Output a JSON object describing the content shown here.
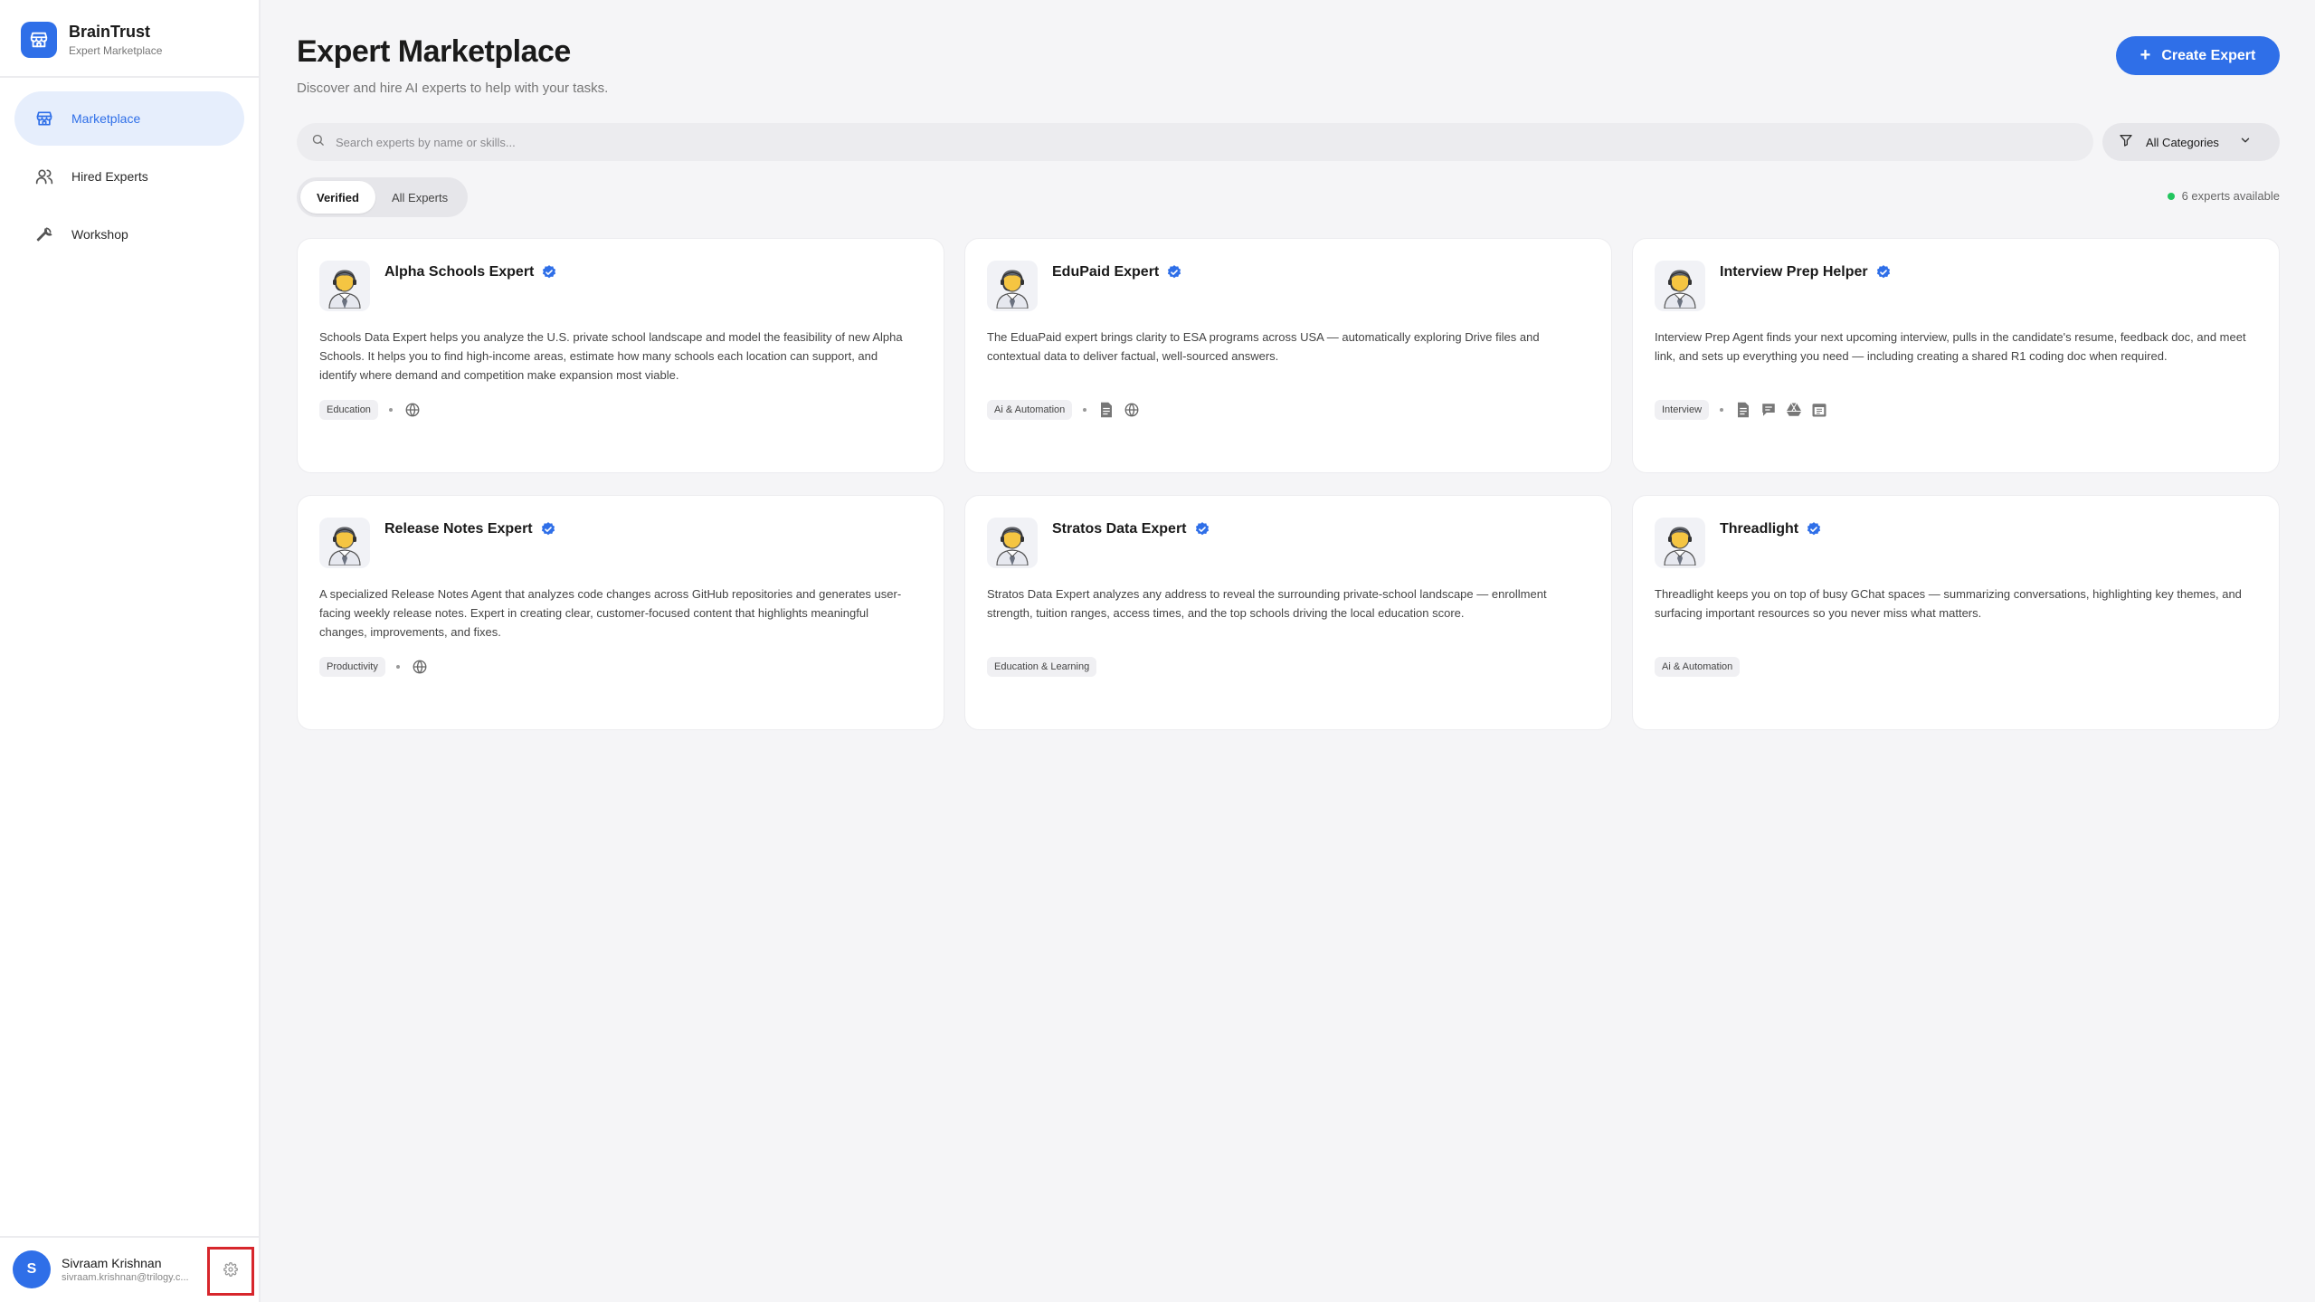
{
  "sidebar": {
    "brand_title": "BrainTrust",
    "brand_subtitle": "Expert Marketplace",
    "items": [
      {
        "label": "Marketplace",
        "icon": "store-icon",
        "active": true
      },
      {
        "label": "Hired Experts",
        "icon": "users-icon",
        "active": false
      },
      {
        "label": "Workshop",
        "icon": "wrench-icon",
        "active": false
      }
    ],
    "user": {
      "initial": "S",
      "name": "Sivraam Krishnan",
      "email": "sivraam.krishnan@trilogy.c..."
    }
  },
  "header": {
    "title": "Expert Marketplace",
    "subtitle": "Discover and hire AI experts to help with your tasks.",
    "create_label": "Create Expert"
  },
  "search": {
    "placeholder": "Search experts by name or skills...",
    "value": ""
  },
  "filter": {
    "selected": "All Categories"
  },
  "tabs": [
    {
      "label": "Verified",
      "active": true
    },
    {
      "label": "All Experts",
      "active": false
    }
  ],
  "available_text": "6 experts available",
  "experts": [
    {
      "name": "Alpha Schools Expert",
      "description": "Schools Data Expert helps you analyze the U.S. private school landscape and model the feasibility of new Alpha Schools. It helps you to find high-income areas, estimate how many schools each location can support, and identify where demand and competition make expansion most viable.",
      "category": "Education",
      "tools": [
        "globe-icon"
      ]
    },
    {
      "name": "EduPaid Expert",
      "description": "The EduaPaid expert brings clarity to ESA programs across USA — automatically exploring Drive files and contextual data to deliver factual, well-sourced answers.",
      "category": "Ai & Automation",
      "tools": [
        "document-icon",
        "globe-icon"
      ]
    },
    {
      "name": "Interview Prep Helper",
      "description": "Interview Prep Agent finds your next upcoming interview, pulls in the candidate's resume, feedback doc, and meet link, and sets up everything you need — including creating a shared R1 coding doc when required.",
      "category": "Interview",
      "tools": [
        "document-icon",
        "chat-icon",
        "drive-icon",
        "calendar-icon"
      ]
    },
    {
      "name": "Release Notes Expert",
      "description": "A specialized Release Notes Agent that analyzes code changes across GitHub repositories and generates user-facing weekly release notes. Expert in creating clear, customer-focused content that highlights meaningful changes, improvements, and fixes.",
      "category": "Productivity",
      "tools": [
        "globe-icon"
      ]
    },
    {
      "name": "Stratos Data Expert",
      "description": "Stratos Data Expert analyzes any address to reveal the surrounding private-school landscape — enrollment strength, tuition ranges, access times, and the top schools driving the local education score.",
      "category": "Education & Learning",
      "tools": []
    },
    {
      "name": "Threadlight",
      "description": "Threadlight keeps you on top of busy GChat spaces — summarizing conversations, highlighting key themes, and surfacing important resources so you never miss what matters.",
      "category": "Ai & Automation",
      "tools": []
    }
  ],
  "colors": {
    "accent": "#2f6fe8",
    "accent_soft": "#e6eefc",
    "available_dot": "#22c55e",
    "highlight_box": "#d7262c"
  }
}
